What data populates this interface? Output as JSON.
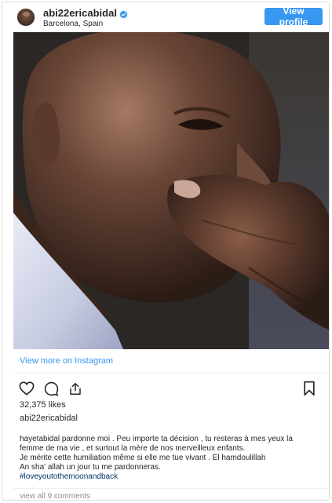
{
  "header": {
    "username": "abi22ericabidal",
    "location": "Barcelona, Spain",
    "view_profile_label": "View profile"
  },
  "post": {
    "view_more_label": "View more on Instagram",
    "likes": "32,375 likes",
    "username": "abi22ericabidal",
    "caption_lines": [
      "hayetabidal pardonne moi . Peu importe ta décision , tu resteras à mes yeux la",
      "femme de ma vie , et surtout la mère de nos merveilleux enfants.",
      "Je mérite cette humiliation même si elle me tue vivant . El hamdoulillah",
      "An sha' allah un jour tu me pardonneras."
    ],
    "hashtag": "#loveyoutothemoonandback",
    "comments_label": "view all 9 comments"
  },
  "colors": {
    "accent": "#3897f0",
    "text": "#262626",
    "muted": "#8e8e8e",
    "border": "#dbdbdb"
  },
  "icons": {
    "verified": "verified-badge-icon",
    "like": "heart-icon",
    "comment": "comment-bubble-icon",
    "share": "share-icon",
    "save": "bookmark-icon"
  }
}
